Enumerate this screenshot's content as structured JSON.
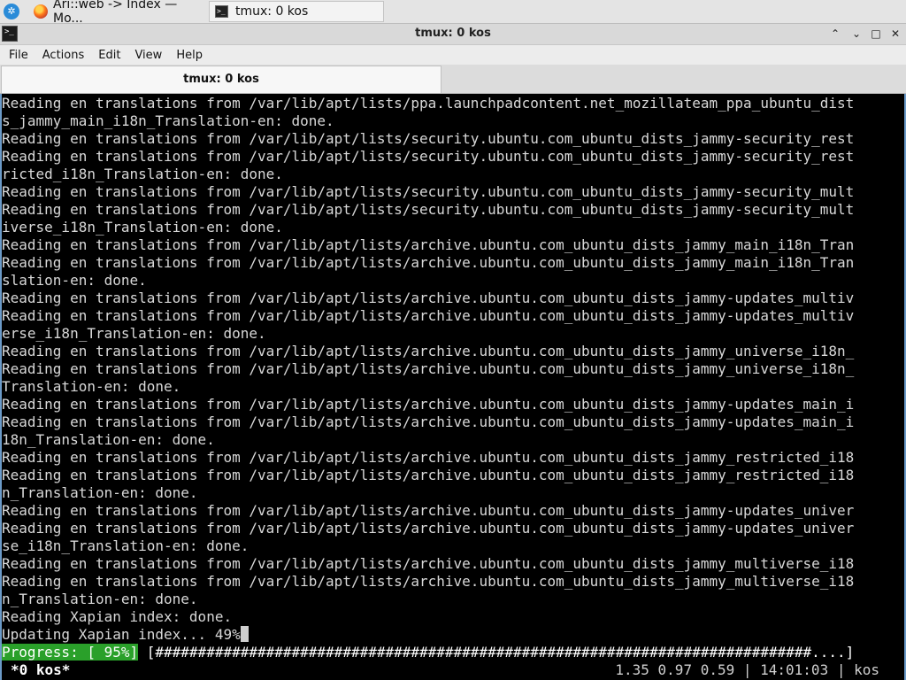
{
  "taskbar": {
    "start_icon": "kde-start-icon",
    "tasks": [
      {
        "label": "Ari::web -> Index — Mo...",
        "icon": "firefox-icon"
      },
      {
        "label": "tmux: 0 kos",
        "icon": "terminal-icon"
      }
    ]
  },
  "window": {
    "title": "tmux: 0 kos",
    "buttons": {
      "minimize": "⌃",
      "restore": "⌄",
      "maximize": "□",
      "close": "✕"
    }
  },
  "menu": [
    "File",
    "Actions",
    "Edit",
    "View",
    "Help"
  ],
  "tab": {
    "label": "tmux: 0 kos"
  },
  "terminal": {
    "lines": [
      "Reading en translations from /var/lib/apt/lists/ppa.launchpadcontent.net_mozillateam_ppa_ubuntu_dist",
      "s_jammy_main_i18n_Translation-en: done.",
      "Reading en translations from /var/lib/apt/lists/security.ubuntu.com_ubuntu_dists_jammy-security_rest",
      "Reading en translations from /var/lib/apt/lists/security.ubuntu.com_ubuntu_dists_jammy-security_rest",
      "ricted_i18n_Translation-en: done.",
      "Reading en translations from /var/lib/apt/lists/security.ubuntu.com_ubuntu_dists_jammy-security_mult",
      "Reading en translations from /var/lib/apt/lists/security.ubuntu.com_ubuntu_dists_jammy-security_mult",
      "iverse_i18n_Translation-en: done.",
      "Reading en translations from /var/lib/apt/lists/archive.ubuntu.com_ubuntu_dists_jammy_main_i18n_Tran",
      "Reading en translations from /var/lib/apt/lists/archive.ubuntu.com_ubuntu_dists_jammy_main_i18n_Tran",
      "slation-en: done.",
      "Reading en translations from /var/lib/apt/lists/archive.ubuntu.com_ubuntu_dists_jammy-updates_multiv",
      "Reading en translations from /var/lib/apt/lists/archive.ubuntu.com_ubuntu_dists_jammy-updates_multiv",
      "erse_i18n_Translation-en: done.",
      "Reading en translations from /var/lib/apt/lists/archive.ubuntu.com_ubuntu_dists_jammy_universe_i18n_",
      "Reading en translations from /var/lib/apt/lists/archive.ubuntu.com_ubuntu_dists_jammy_universe_i18n_",
      "Translation-en: done.",
      "Reading en translations from /var/lib/apt/lists/archive.ubuntu.com_ubuntu_dists_jammy-updates_main_i",
      "Reading en translations from /var/lib/apt/lists/archive.ubuntu.com_ubuntu_dists_jammy-updates_main_i",
      "18n_Translation-en: done.",
      "Reading en translations from /var/lib/apt/lists/archive.ubuntu.com_ubuntu_dists_jammy_restricted_i18",
      "Reading en translations from /var/lib/apt/lists/archive.ubuntu.com_ubuntu_dists_jammy_restricted_i18",
      "n_Translation-en: done.",
      "Reading en translations from /var/lib/apt/lists/archive.ubuntu.com_ubuntu_dists_jammy-updates_univer",
      "Reading en translations from /var/lib/apt/lists/archive.ubuntu.com_ubuntu_dists_jammy-updates_univer",
      "se_i18n_Translation-en: done.",
      "Reading en translations from /var/lib/apt/lists/archive.ubuntu.com_ubuntu_dists_jammy_multiverse_i18",
      "Reading en translations from /var/lib/apt/lists/archive.ubuntu.com_ubuntu_dists_jammy_multiverse_i18",
      "n_Translation-en: done.",
      "Reading Xapian index: done."
    ],
    "current_line": "Updating Xapian index... 49%",
    "progress": {
      "label": "Progress: [ 95%]",
      "bar": " [#############################################################################....] "
    }
  },
  "tmux_status": {
    "window_list": "*0 kos*",
    "right": "1.35 0.97 0.59 | 14:01:03 | kos"
  },
  "colors": {
    "terminal_bg": "#000000",
    "terminal_fg": "#d8d8d8",
    "progress_bg": "#2aa02a",
    "accent_border": "#6b9ac8"
  }
}
